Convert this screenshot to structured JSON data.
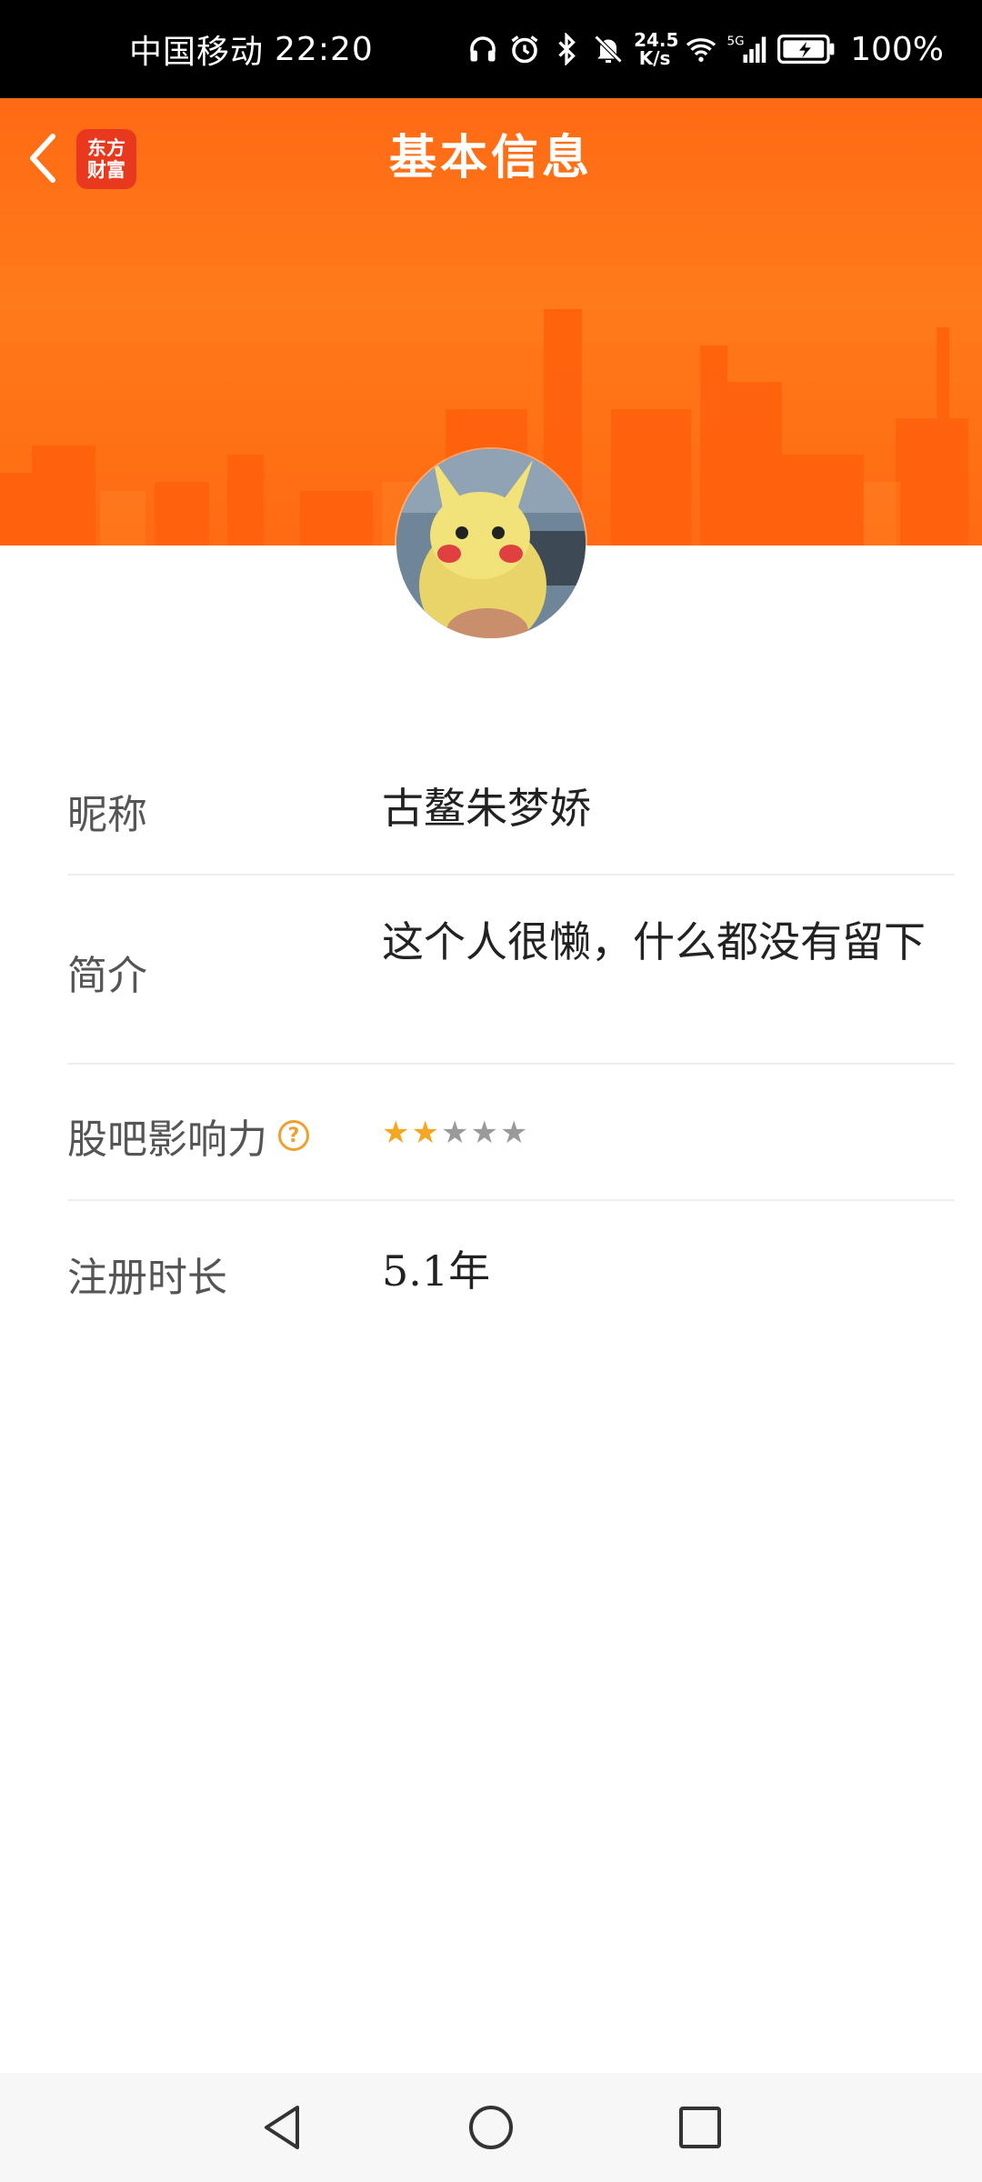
{
  "status_bar": {
    "carrier": "中国移动",
    "time": "22:20",
    "net_speed_value": "24.5",
    "net_speed_unit": "K/s",
    "battery": "100%",
    "icons": [
      "headphones-icon",
      "alarm-icon",
      "bluetooth-icon",
      "mute-icon",
      "wifi-icon",
      "5g-signal-icon",
      "battery-icon"
    ]
  },
  "header": {
    "title": "基本信息",
    "logo_line1": "东方",
    "logo_line2": "财富",
    "accent_color": "#ff6a14"
  },
  "profile": {
    "rows": [
      {
        "label": "昵称",
        "value": "古鳌朱梦娇"
      },
      {
        "label": "简介",
        "value": "这个人很懒，什么都没有留下"
      },
      {
        "label": "股吧影响力",
        "help": "?",
        "stars_filled": 2,
        "stars_total": 5
      },
      {
        "label": "注册时长",
        "value": "5.1年"
      }
    ]
  },
  "colors": {
    "star_on": "#f5a623",
    "star_off": "#9a9a9a",
    "divider": "#eeeeee"
  }
}
